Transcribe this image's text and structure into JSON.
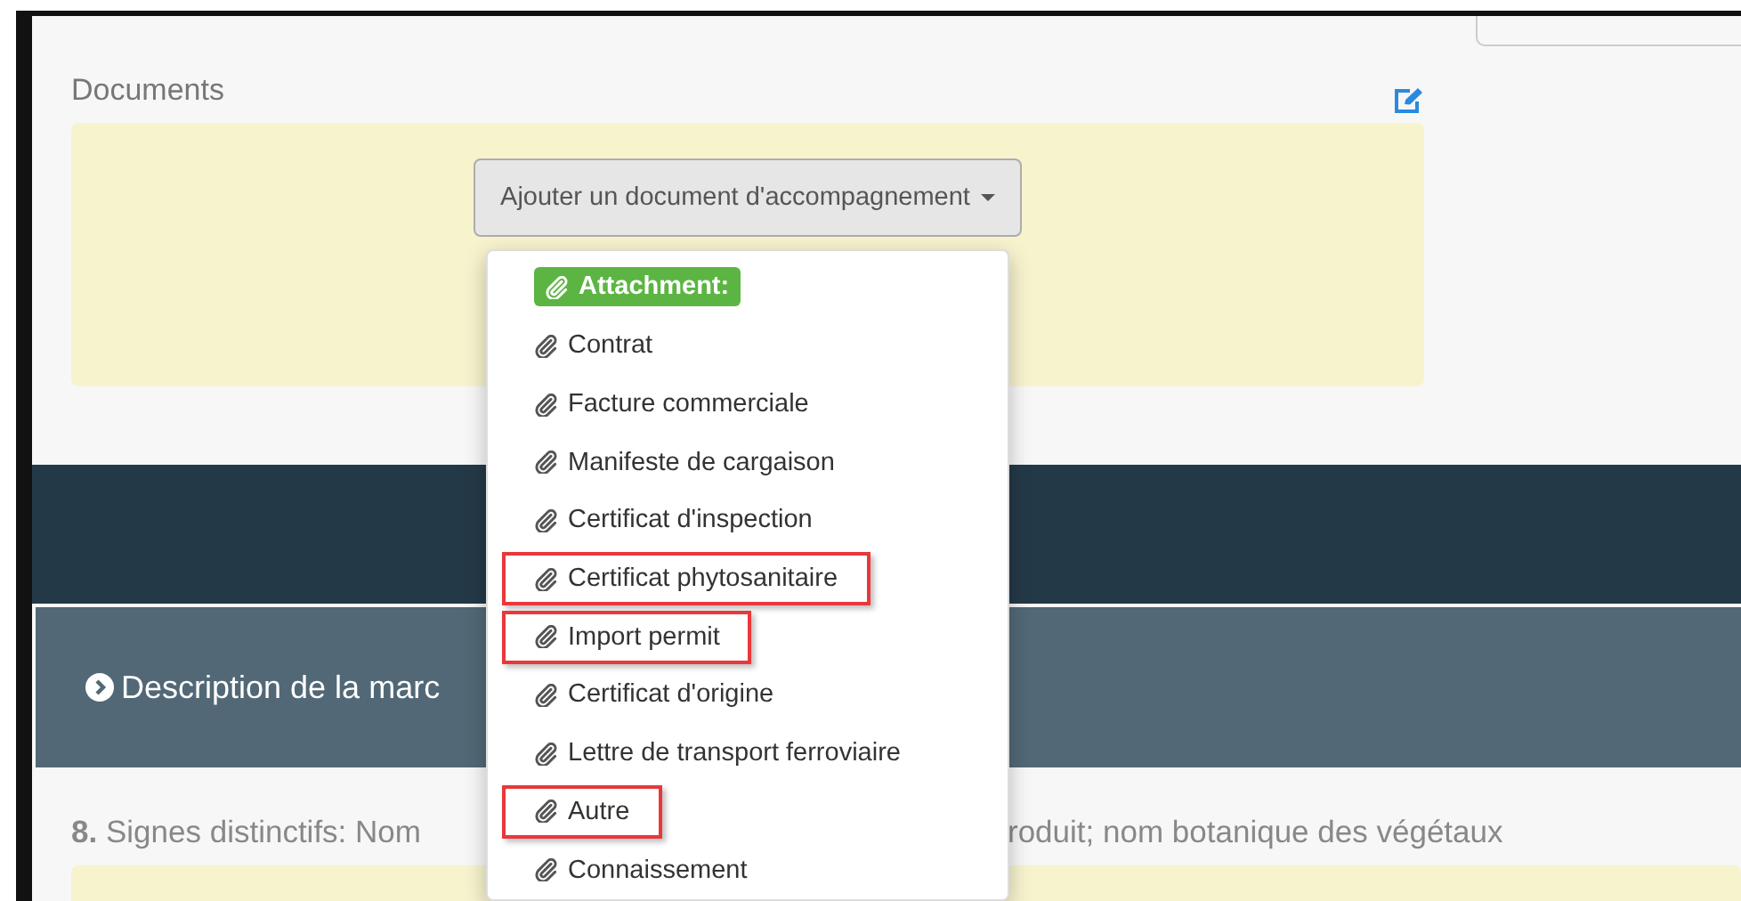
{
  "documents": {
    "title": "Documents",
    "add_button": "Ajouter un document d'accompagnement"
  },
  "menu": {
    "header": "Attachment:",
    "items": [
      {
        "label": "Contrat",
        "highlighted": false
      },
      {
        "label": "Facture commerciale",
        "highlighted": false
      },
      {
        "label": "Manifeste de cargaison",
        "highlighted": false
      },
      {
        "label": "Certificat d'inspection",
        "highlighted": false
      },
      {
        "label": "Certificat phytosanitaire",
        "highlighted": true
      },
      {
        "label": "Import permit",
        "highlighted": true
      },
      {
        "label": "Certificat d'origine",
        "highlighted": false
      },
      {
        "label": "Lettre de transport ferroviaire",
        "highlighted": false
      },
      {
        "label": "Autre",
        "highlighted": true
      },
      {
        "label": "Connaissement",
        "highlighted": false
      }
    ]
  },
  "section_header": {
    "title": "Description de la marc"
  },
  "field_8": {
    "number": "8.",
    "label_start": "Signes distinctifs: Nom",
    "label_end": "roduit; nom botanique des végétaux"
  }
}
